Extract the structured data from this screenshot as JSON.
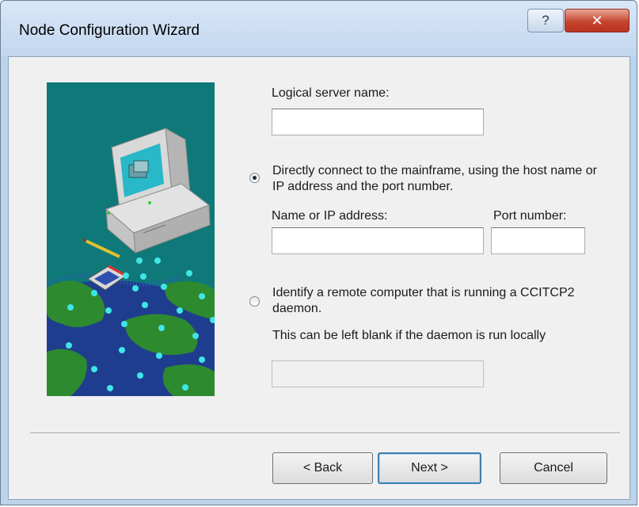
{
  "window": {
    "title": "Node Configuration Wizard",
    "help_glyph": "?",
    "close_glyph": "✕"
  },
  "form": {
    "logical_server_label": "Logical server name:",
    "logical_server_value": "",
    "option_direct": {
      "label": "Directly connect to the mainframe, using the host name or IP address and the port number.",
      "selected": true
    },
    "name_ip_label": "Name or IP address:",
    "name_ip_value": "",
    "port_label": "Port number:",
    "port_value": "",
    "option_remote": {
      "label": "Identify a remote computer that is running a CCITCP2 daemon.",
      "selected": false
    },
    "remote_hint": "This can be left blank if the daemon is run locally",
    "remote_value": ""
  },
  "buttons": {
    "back": "< Back",
    "next": "Next >",
    "cancel": "Cancel"
  },
  "icons": {
    "help": "help-icon",
    "close": "close-icon",
    "illustration": "computer-network-illustration"
  },
  "colors": {
    "illustration_bg": "#0f7878",
    "ocean": "#1f3d8f",
    "land": "#2e8a2e",
    "network_nodes": "#3fe6e6"
  }
}
